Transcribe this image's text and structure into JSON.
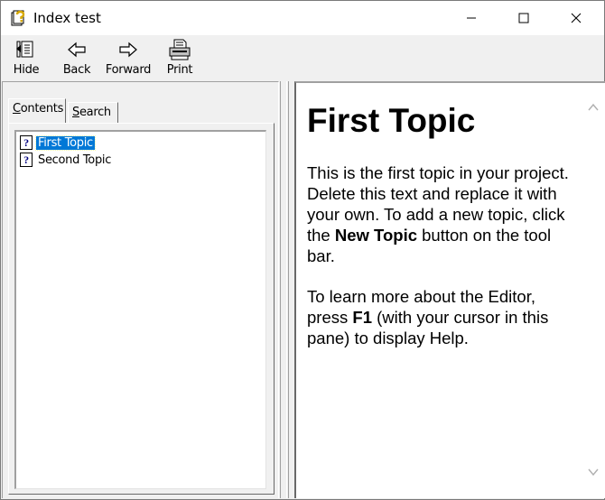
{
  "window": {
    "title": "Index test"
  },
  "toolbar": {
    "hide": {
      "label": "Hide",
      "icon": "hide-pane-icon"
    },
    "back": {
      "label": "Back",
      "icon": "back-arrow-icon"
    },
    "forward": {
      "label": "Forward",
      "icon": "forward-arrow-icon"
    },
    "print": {
      "label": "Print",
      "icon": "printer-icon"
    }
  },
  "tabs": {
    "contents": {
      "prefix": "C",
      "rest": "ontents",
      "active": true
    },
    "search": {
      "prefix": "S",
      "rest": "earch",
      "active": false
    }
  },
  "tree": {
    "items": [
      {
        "label": "First Topic",
        "selected": true,
        "icon": "help-topic-icon",
        "icon_glyph": "?"
      },
      {
        "label": "Second Topic",
        "selected": false,
        "icon": "help-topic-icon",
        "icon_glyph": "?"
      }
    ]
  },
  "article": {
    "heading": "First Topic",
    "p1": {
      "before": "This is the first topic in your project. Delete this text and replace it with your own. To add a new topic, click the ",
      "bold": "New Topic",
      "after": " button on the tool bar."
    },
    "p2": {
      "before": "To learn more about the Editor, press ",
      "bold": "F1",
      "after": " (with your cursor in this pane) to display Help."
    }
  },
  "colors": {
    "selection": "#0078d7",
    "chrome": "#f0f0f0"
  }
}
